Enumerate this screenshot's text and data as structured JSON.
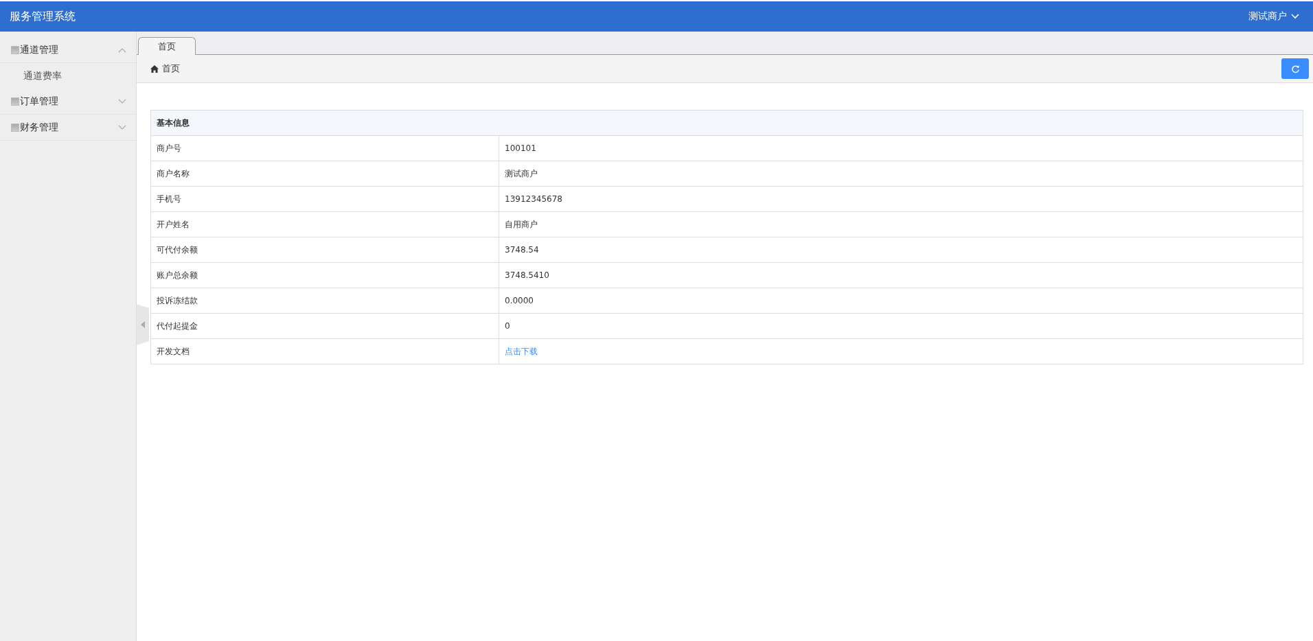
{
  "header": {
    "title": "服务管理系统",
    "user": "测试商户"
  },
  "sidebar": {
    "items": [
      {
        "label": "通道管理",
        "expanded": true,
        "children": [
          {
            "label": "通道费率"
          }
        ]
      },
      {
        "label": "订单管理",
        "expanded": false
      },
      {
        "label": "财务管理",
        "expanded": false
      }
    ]
  },
  "tabs": [
    {
      "label": "首页",
      "selected": true
    }
  ],
  "breadcrumb": "首页",
  "table": {
    "title": "基本信息",
    "rows": [
      {
        "label": "商户号",
        "value": "100101",
        "kind": "text"
      },
      {
        "label": "商户名称",
        "value": "测试商户",
        "kind": "text"
      },
      {
        "label": "手机号",
        "value": "13912345678",
        "kind": "text"
      },
      {
        "label": "开户姓名",
        "value": "自用商户",
        "kind": "text"
      },
      {
        "label": "可代付余额",
        "value": "3748.54",
        "kind": "text"
      },
      {
        "label": "账户总余额",
        "value": "3748.5410",
        "kind": "text"
      },
      {
        "label": "投诉冻结款",
        "value": "0.0000",
        "kind": "text"
      },
      {
        "label": "代付起提金",
        "value": "0",
        "kind": "text"
      },
      {
        "label": "开发文档",
        "value": "点击下载",
        "kind": "link"
      }
    ]
  }
}
